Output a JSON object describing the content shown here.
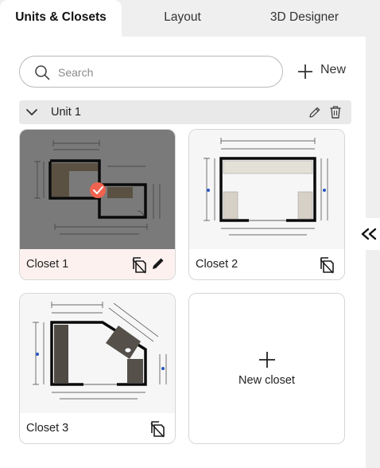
{
  "tabs": [
    {
      "label": "Units & Closets",
      "active": true
    },
    {
      "label": "Layout",
      "active": false
    },
    {
      "label": "3D Designer",
      "active": false
    }
  ],
  "search": {
    "placeholder": "Search",
    "value": ""
  },
  "toolbar": {
    "new_label": "New"
  },
  "unit": {
    "name": "Unit 1",
    "expanded": true
  },
  "closets": [
    {
      "name": "Closet 1",
      "selected": true
    },
    {
      "name": "Closet 2",
      "selected": false
    },
    {
      "name": "Closet 3",
      "selected": false
    }
  ],
  "new_closet": {
    "label": "New closet"
  },
  "colors": {
    "accent": "#f0634f",
    "panel": "#ffffff",
    "tab_bar": "#efefef",
    "selected_footer": "#fdf1ef"
  },
  "icons": [
    "search-icon",
    "plus-icon",
    "chevron-down-icon",
    "pencil-icon",
    "trash-icon",
    "copy-icon",
    "check-icon",
    "double-chevron-left-icon"
  ]
}
